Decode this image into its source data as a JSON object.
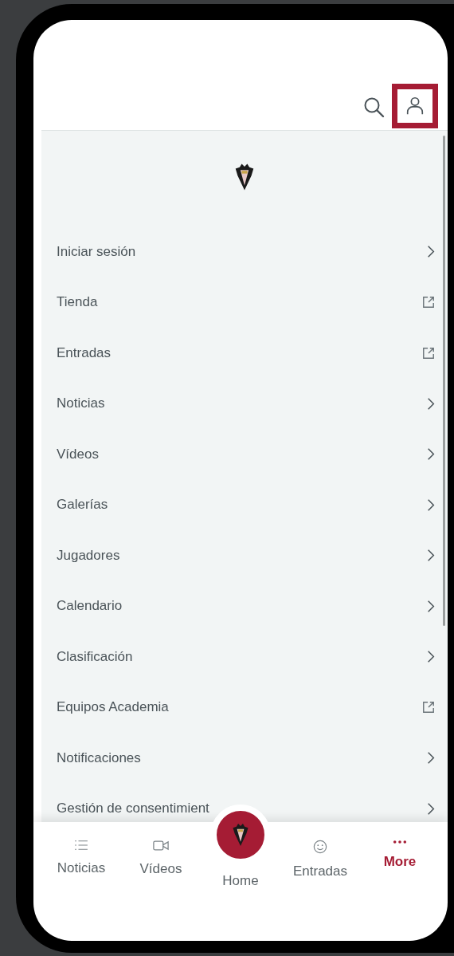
{
  "header": {
    "account_button": {
      "highlighted": true
    }
  },
  "menu": [
    {
      "label": "Iniciar sesión",
      "kind": "chevron"
    },
    {
      "label": "Tienda",
      "kind": "external"
    },
    {
      "label": "Entradas",
      "kind": "external"
    },
    {
      "label": "Noticias",
      "kind": "chevron"
    },
    {
      "label": "Vídeos",
      "kind": "chevron"
    },
    {
      "label": "Galerías",
      "kind": "chevron"
    },
    {
      "label": "Jugadores",
      "kind": "chevron"
    },
    {
      "label": "Calendario",
      "kind": "chevron"
    },
    {
      "label": "Clasificación",
      "kind": "chevron"
    },
    {
      "label": "Equipos Academia",
      "kind": "external"
    },
    {
      "label": "Notificaciones",
      "kind": "chevron"
    },
    {
      "label": "Gestión de consentimient",
      "kind": "chevron"
    }
  ],
  "tab_bar": [
    {
      "label": "Noticias",
      "kind": "list",
      "selected": false
    },
    {
      "label": "Vídeos",
      "kind": "video",
      "selected": false
    },
    {
      "label": "Home",
      "kind": "home",
      "selected": false
    },
    {
      "label": "Entradas",
      "kind": "smile",
      "selected": false
    },
    {
      "label": "More",
      "kind": "more",
      "selected": true
    }
  ]
}
